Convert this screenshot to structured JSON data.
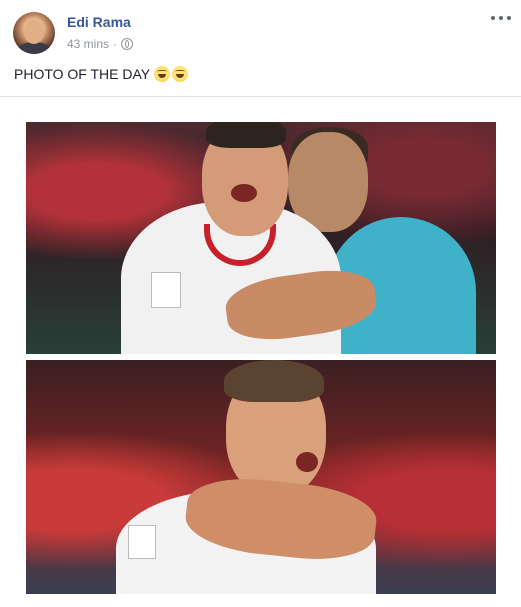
{
  "post": {
    "author": "Edi Rama",
    "time": "43 mins",
    "separator": "·",
    "privacy_icon": "globe-icon",
    "more_icon": "more-options-icon",
    "caption": "PHOTO OF THE DAY",
    "caption_emojis": [
      "grinning-squinting-face",
      "grinning-squinting-face"
    ]
  },
  "colors": {
    "author_link": "#385898",
    "meta_text": "#90949c",
    "body_text": "#1d2129",
    "divider": "#dddfe2"
  }
}
